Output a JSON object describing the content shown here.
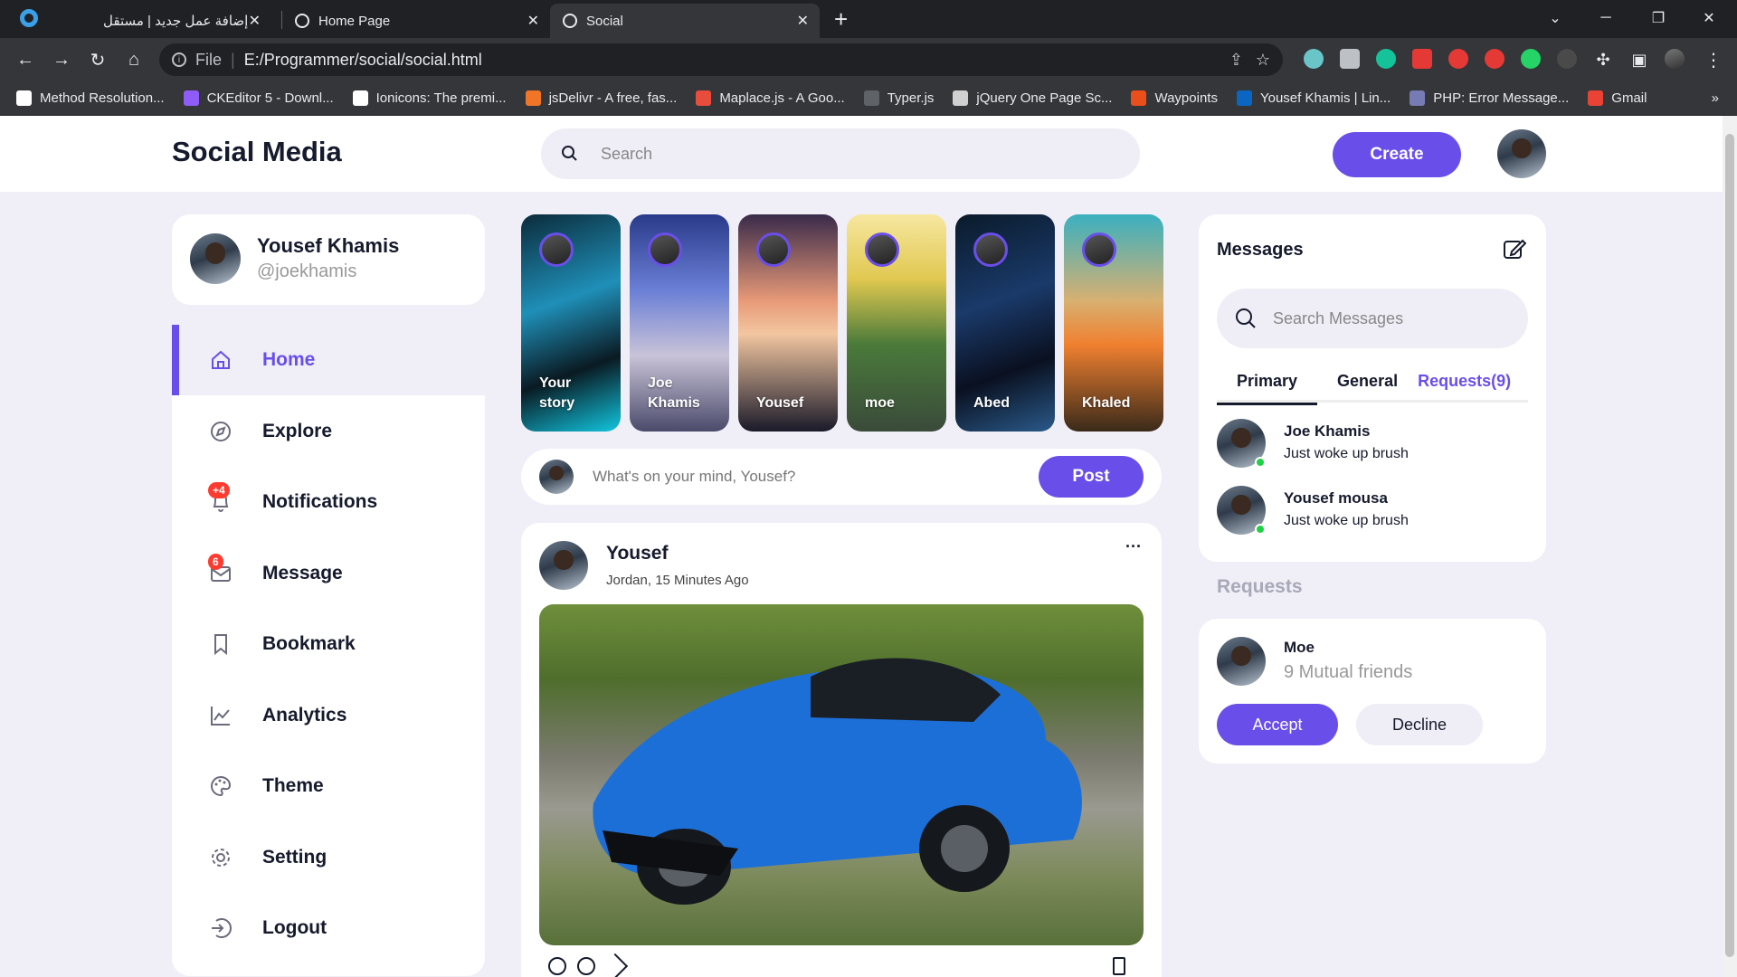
{
  "browser": {
    "tabs": [
      {
        "title": "إضافة عمل جديد | مستقل",
        "favicon": "mostaql-icon"
      },
      {
        "title": "Home Page",
        "favicon": "globe-icon"
      },
      {
        "title": "Social",
        "favicon": "globe-icon"
      }
    ],
    "new_tab": "+",
    "address": {
      "scheme_label": "File",
      "url": "E:/Programmer/social/social.html"
    },
    "bookmarks": [
      {
        "label": "Method Resolution...",
        "color": "#ffffff"
      },
      {
        "label": "CKEditor 5 - Downl...",
        "color": "#8f5cf7"
      },
      {
        "label": "Ionicons: The premi...",
        "color": "#ffffff"
      },
      {
        "label": "jsDelivr - A free, fas...",
        "color": "#f17527"
      },
      {
        "label": "Maplace.js - A Goo...",
        "color": "#e84c3d"
      },
      {
        "label": "Typer.js",
        "color": "#5f6368"
      },
      {
        "label": "jQuery One Page Sc...",
        "color": "#d0d0d0"
      },
      {
        "label": "Waypoints",
        "color": "#e94e1b"
      },
      {
        "label": "Yousef Khamis | Lin...",
        "color": "#0a66c2"
      },
      {
        "label": "PHP: Error Message...",
        "color": "#777bb3"
      },
      {
        "label": "Gmail",
        "color": "#ea4335"
      }
    ],
    "more": "»"
  },
  "app": {
    "logo": "Social Media",
    "search_placeholder": "Search",
    "create_label": "Create"
  },
  "profile": {
    "name": "Yousef Khamis",
    "handle": "@joekhamis"
  },
  "menu": [
    {
      "label": "Home",
      "icon": "home-icon",
      "active": true
    },
    {
      "label": "Explore",
      "icon": "compass-icon"
    },
    {
      "label": "Notifications",
      "icon": "bell-icon",
      "badge": "+4"
    },
    {
      "label": "Message",
      "icon": "mail-icon",
      "badge": "6"
    },
    {
      "label": "Bookmark",
      "icon": "bookmark-icon"
    },
    {
      "label": "Analytics",
      "icon": "analytics-icon"
    },
    {
      "label": "Theme",
      "icon": "palette-icon"
    },
    {
      "label": "Setting",
      "icon": "gear-icon"
    },
    {
      "label": "Logout",
      "icon": "logout-icon"
    }
  ],
  "stories": [
    {
      "line1": "Your",
      "line2": "story"
    },
    {
      "line1": "Joe",
      "line2": "Khamis"
    },
    {
      "line1": "Yousef",
      "line2": ""
    },
    {
      "line1": "moe",
      "line2": ""
    },
    {
      "line1": "Abed",
      "line2": ""
    },
    {
      "line1": "Khaled",
      "line2": ""
    }
  ],
  "composer": {
    "placeholder": "What's on your mind, Yousef?",
    "post_label": "Post"
  },
  "post": {
    "author": "Yousef",
    "meta": "Jordan, 15 Minutes Ago",
    "more": "···"
  },
  "messages": {
    "title": "Messages",
    "search_placeholder": "Search Messages",
    "tabs": [
      "Primary",
      "General",
      "Requests(9)"
    ],
    "items": [
      {
        "name": "Joe Khamis",
        "text": "Just woke up brush"
      },
      {
        "name": "Yousef mousa",
        "text": "Just woke up brush"
      }
    ]
  },
  "requests": {
    "title": "Requests",
    "name": "Moe",
    "mutual": "9 Mutual friends",
    "accept": "Accept",
    "decline": "Decline"
  },
  "colors": {
    "accent": "#6a4ee9",
    "badge": "#ff3b30",
    "online": "#20d146"
  }
}
